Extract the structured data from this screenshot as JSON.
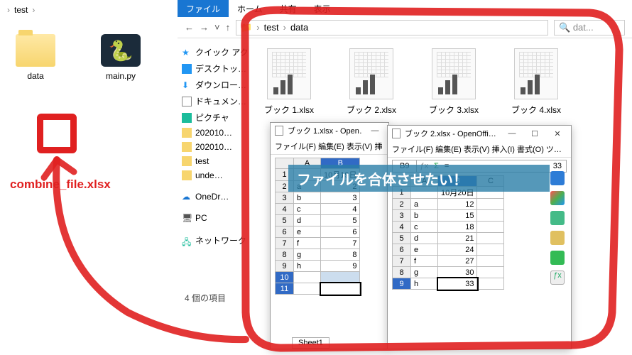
{
  "window1": {
    "breadcrumb": [
      "test"
    ],
    "icons": [
      {
        "name": "data",
        "type": "folder"
      },
      {
        "name": "main.py",
        "type": "python"
      }
    ]
  },
  "annotation": {
    "label": "combine_file.xlsx"
  },
  "window2": {
    "ribbon": [
      "ファイル",
      "ホーム",
      "共有",
      "表示"
    ],
    "path": [
      "test",
      "data"
    ],
    "search_placeholder": "dat...",
    "sidebar": {
      "quick": "クイック アクセ…",
      "items": [
        "デスクトッ…",
        "ダウンロー…",
        "ドキュメン…",
        "ピクチャ",
        "202010…",
        "202010…",
        "test",
        "unde…"
      ],
      "onedrive": "OneDr…",
      "pc": "PC",
      "net": "ネットワーク"
    },
    "files": [
      "ブック 1.xlsx",
      "ブック 2.xlsx",
      "ブック 3.xlsx",
      "ブック 4.xlsx"
    ],
    "status": "4 個の項目"
  },
  "banner": "ファイルを合体させたい！",
  "ss1": {
    "title": "ブック 1.xlsx - Open…",
    "menu": "ファイル(F)  編集(E)  表示(V)  挿",
    "header_date": "10月19日",
    "rows": [
      [
        "a",
        "2"
      ],
      [
        "b",
        "3"
      ],
      [
        "c",
        "4"
      ],
      [
        "d",
        "5"
      ],
      [
        "e",
        "6"
      ],
      [
        "f",
        "7"
      ],
      [
        "g",
        "8"
      ],
      [
        "h",
        "9"
      ]
    ],
    "sheet_tab": "Sheet1"
  },
  "ss2": {
    "title": "ブック 2.xlsx - OpenOffi…",
    "menu": "ファイル(F)  編集(E)  表示(V)  挿入(I)  書式(O)  ツ…",
    "cellref": "B9",
    "cellval": "33",
    "header_date": "10月20日",
    "rows": [
      [
        "a",
        "12"
      ],
      [
        "b",
        "15"
      ],
      [
        "c",
        "18"
      ],
      [
        "d",
        "21"
      ],
      [
        "e",
        "24"
      ],
      [
        "f",
        "27"
      ],
      [
        "g",
        "30"
      ],
      [
        "h",
        "33"
      ]
    ]
  },
  "chart_data": [
    {
      "type": "table",
      "title": "ブック 1.xlsx",
      "columns": [
        "A",
        "B"
      ],
      "header_row": [
        "",
        "10月19日"
      ],
      "rows": [
        [
          "a",
          2
        ],
        [
          "b",
          3
        ],
        [
          "c",
          4
        ],
        [
          "d",
          5
        ],
        [
          "e",
          6
        ],
        [
          "f",
          7
        ],
        [
          "g",
          8
        ],
        [
          "h",
          9
        ]
      ]
    },
    {
      "type": "table",
      "title": "ブック 2.xlsx",
      "columns": [
        "A",
        "B"
      ],
      "header_row": [
        "",
        "10月20日"
      ],
      "rows": [
        [
          "a",
          12
        ],
        [
          "b",
          15
        ],
        [
          "c",
          18
        ],
        [
          "d",
          21
        ],
        [
          "e",
          24
        ],
        [
          "f",
          27
        ],
        [
          "g",
          30
        ],
        [
          "h",
          33
        ]
      ]
    }
  ]
}
